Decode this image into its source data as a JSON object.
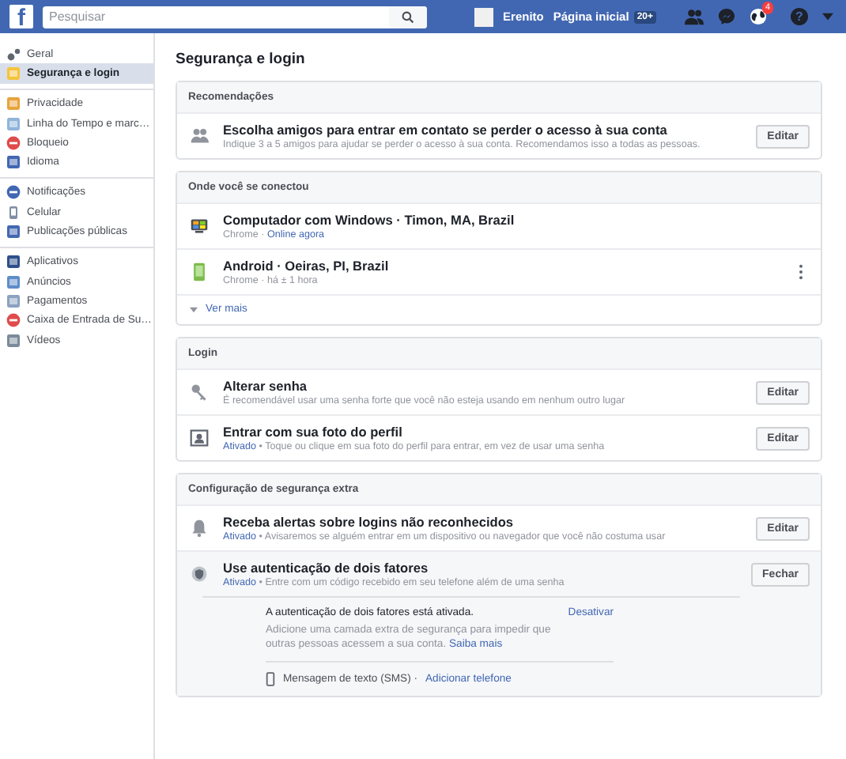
{
  "topbar": {
    "logo": "f",
    "search": {
      "placeholder": "Pesquisar"
    },
    "user": "Erenito",
    "home": "Página inicial",
    "home_badge": "20+",
    "notifications": "4",
    "help": "?"
  },
  "sidebar": {
    "groups": [
      [
        {
          "label": "Geral",
          "selected": false
        },
        {
          "label": "Segurança e login",
          "selected": true
        }
      ],
      [
        {
          "label": "Privacidade",
          "selected": false
        },
        {
          "label": "Linha do Tempo e marc…",
          "selected": false
        },
        {
          "label": "Bloqueio",
          "selected": false
        },
        {
          "label": "Idioma",
          "selected": false
        }
      ],
      [
        {
          "label": "Notificações",
          "selected": false
        },
        {
          "label": "Celular",
          "selected": false
        },
        {
          "label": "Publicações públicas",
          "selected": false
        }
      ],
      [
        {
          "label": "Aplicativos",
          "selected": false
        },
        {
          "label": "Anúncios",
          "selected": false
        },
        {
          "label": "Pagamentos",
          "selected": false
        },
        {
          "label": "Caixa de Entrada de Su…",
          "selected": false
        },
        {
          "label": "Vídeos",
          "selected": false
        }
      ]
    ]
  },
  "page_title": "Segurança e login",
  "sections": [
    {
      "title": "Recomendações",
      "rows": [
        {
          "kind": "setting",
          "title": "Escolha amigos para entrar em contato se perder o acesso à sua conta",
          "description": "Indique 3 a 5 amigos para ajudar se perder o acesso à sua conta. Recomendamos isso a todas as pessoas.",
          "button": "Editar"
        }
      ]
    },
    {
      "title": "Onde você se conectou",
      "rows": [
        {
          "kind": "device",
          "title": "Computador com Windows · Timon, MA, Brazil",
          "browser": "Chrome ·",
          "activity": "Online agora",
          "online": true,
          "menu": false
        },
        {
          "kind": "device",
          "title": "Android · Oeiras, PI, Brazil",
          "browser": "Chrome ·",
          "activity": "há ± 1 hora",
          "online": false,
          "menu": true
        }
      ],
      "more": "Ver mais"
    },
    {
      "title": "Login",
      "rows": [
        {
          "kind": "setting",
          "title": "Alterar senha",
          "description": "É recomendável usar uma senha forte que você não esteja usando em nenhum outro lugar",
          "button": "Editar"
        },
        {
          "kind": "setting",
          "title": "Entrar com sua foto do perfil",
          "status": "Ativado",
          "description": "• Toque ou clique em sua foto do perfil para entrar, em vez de usar uma senha",
          "button": "Editar"
        }
      ]
    },
    {
      "title": "Configuração de segurança extra",
      "rows": [
        {
          "kind": "setting",
          "title": "Receba alertas sobre logins não reconhecidos",
          "status": "Ativado",
          "description": "• Avisaremos se alguém entrar em um dispositivo ou navegador que você não costuma usar",
          "button": "Editar"
        },
        {
          "kind": "setting",
          "title": "Use autenticação de dois fatores",
          "status": "Ativado",
          "description": "• Entre com um código recebido em seu telefone além de uma senha",
          "button": "Fechar",
          "expanded": true,
          "details": {
            "heading": "A autenticação de dois fatores está ativada.",
            "action": "Desativar",
            "text": "Adicione uma camada extra de segurança para impedir que outras pessoas acessem a sua conta.",
            "link": "Saiba mais",
            "method": "Mensagem de texto (SMS) ·",
            "method_link": "Adicionar telefone"
          }
        }
      ]
    }
  ]
}
